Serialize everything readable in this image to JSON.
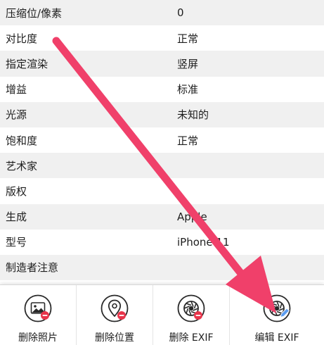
{
  "exif_rows": [
    {
      "label": "压缩位/像素",
      "value": "0"
    },
    {
      "label": "对比度",
      "value": "正常"
    },
    {
      "label": "指定渲染",
      "value": "竖屏"
    },
    {
      "label": "增益",
      "value": "标准"
    },
    {
      "label": "光源",
      "value": "未知的"
    },
    {
      "label": "饱和度",
      "value": "正常"
    },
    {
      "label": "艺术家",
      "value": ""
    },
    {
      "label": "版权",
      "value": ""
    },
    {
      "label": "生成",
      "value": "Apple"
    },
    {
      "label": "型号",
      "value": "iPhone 11"
    },
    {
      "label": "制造者注意",
      "value": ""
    }
  ],
  "toolbar": {
    "delete_photo": "删除照片",
    "delete_location": "删除位置",
    "delete_exif": "删除 EXIF",
    "edit_exif": "编辑 EXIF"
  },
  "colors": {
    "annotation_arrow": "#f0406a",
    "badge_red": "#e8344a",
    "edit_badge_blue": "#5b9cf0",
    "row_stripe": "#f0f0f0"
  },
  "icons": {
    "delete_photo": "photo-delete-icon",
    "delete_location": "location-pin-delete-icon",
    "delete_exif": "aperture-delete-icon",
    "edit_exif": "aperture-edit-icon"
  }
}
